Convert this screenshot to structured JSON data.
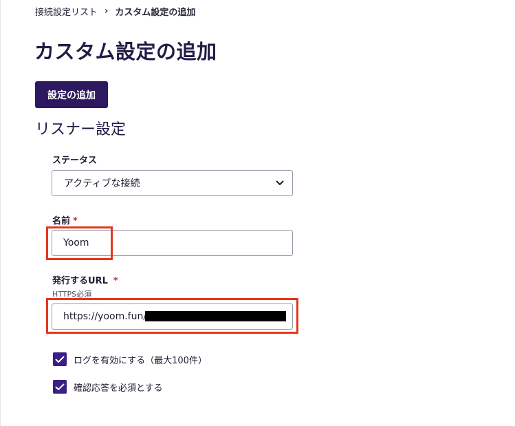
{
  "breadcrumb": {
    "parent": "接続設定リスト",
    "separator": "›",
    "current": "カスタム設定の追加"
  },
  "page_title": "カスタム設定の追加",
  "add_button_label": "設定の追加",
  "section_title": "リスナー設定",
  "status_field": {
    "label": "ステータス",
    "selected_value": "アクティブな接続"
  },
  "name_field": {
    "label": "名前",
    "required_mark": "*",
    "value": "Yoom"
  },
  "url_field": {
    "label": "発行するURL",
    "required_mark": "*",
    "hint": "HTTPS必須",
    "value": "https://yoom.fun/"
  },
  "checkboxes": [
    {
      "label": "ログを有効にする（最大100件）",
      "checked": true
    },
    {
      "label": "確認応答を必須とする",
      "checked": true
    }
  ],
  "colors": {
    "primary": "#2d1a5e",
    "checkbox": "#3a1f86",
    "required": "#d2263b",
    "highlight": "#e3371e"
  }
}
